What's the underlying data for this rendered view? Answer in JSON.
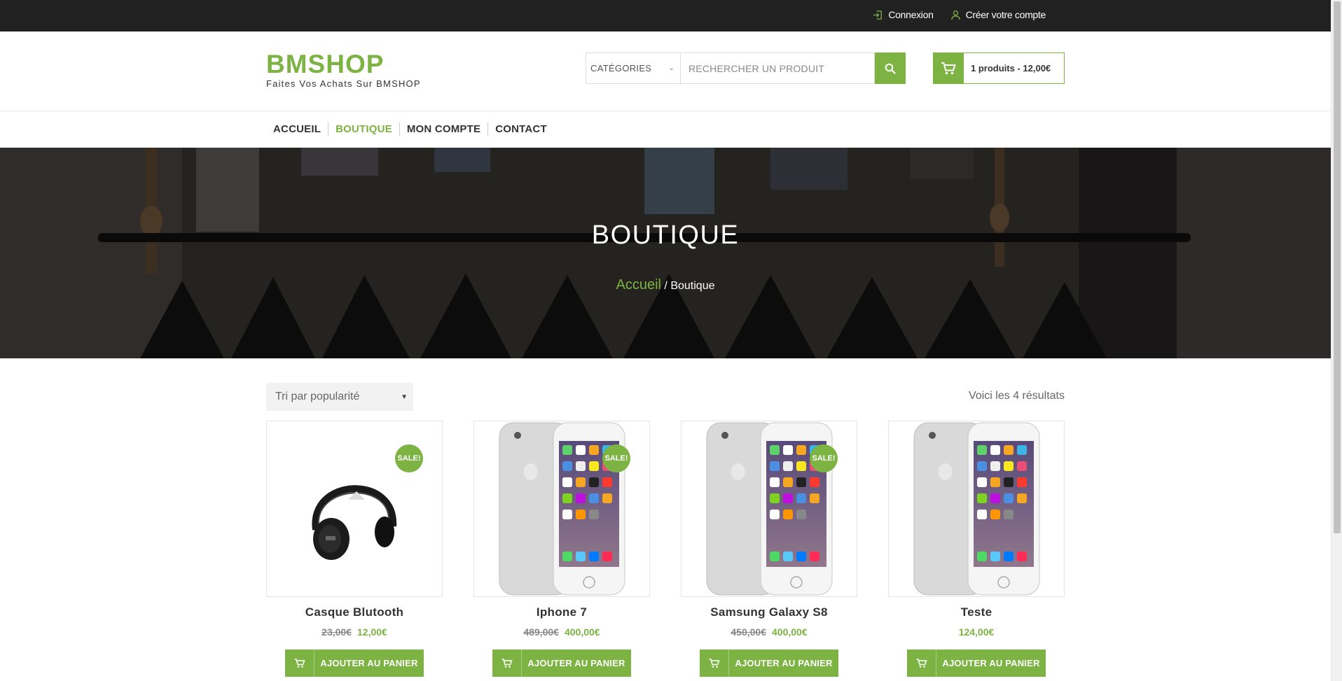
{
  "topbar": {
    "login_label": "Connexion",
    "register_label": "Créer votre compte"
  },
  "header": {
    "logo_title": "BMSHOP",
    "logo_tagline": "Faites Vos Achats Sur BMSHOP",
    "search": {
      "category_label": "CATÉGORIES",
      "placeholder": "RECHERCHER UN PRODUIT"
    },
    "cart_summary": "1 produits - 12,00€"
  },
  "nav": {
    "items": [
      {
        "label": "ACCUEIL"
      },
      {
        "label": "BOUTIQUE"
      },
      {
        "label": "MON COMPTE"
      },
      {
        "label": "CONTACT"
      }
    ]
  },
  "hero": {
    "title": "BOUTIQUE",
    "breadcrumb_home": "Accueil",
    "breadcrumb_sep": " / ",
    "breadcrumb_current": "Boutique"
  },
  "shop": {
    "sort_label": "Tri par popularité",
    "results_text": "Voici les 4 résultats"
  },
  "products": [
    {
      "name": "Casque Blutooth",
      "old_price": "23,00€",
      "price": "12,00€",
      "sale": "SALE!",
      "image": "headphones",
      "button": "AJOUTER AU PANIER"
    },
    {
      "name": "Iphone 7",
      "old_price": "489,00€",
      "price": "400,00€",
      "sale": "SALE!",
      "image": "iphone",
      "button": "AJOUTER AU PANIER"
    },
    {
      "name": "Samsung Galaxy S8",
      "old_price": "450,00€",
      "price": "400,00€",
      "sale": "SALE!",
      "image": "iphone",
      "button": "AJOUTER AU PANIER"
    },
    {
      "name": "Teste",
      "old_price": "",
      "price": "124,00€",
      "sale": "",
      "image": "iphone",
      "button": "AJOUTER AU PANIER"
    }
  ],
  "colors": {
    "accent": "#7cb342",
    "topbar": "#212121"
  }
}
